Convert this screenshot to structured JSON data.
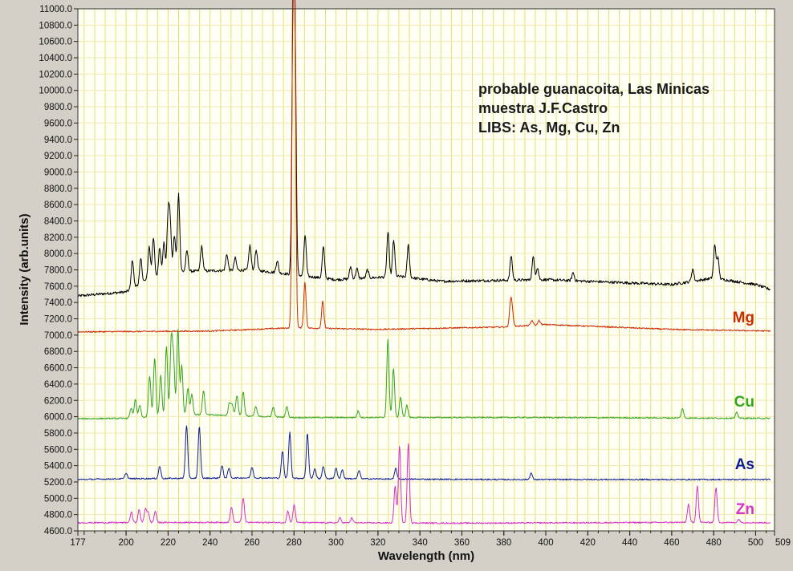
{
  "chart_data": {
    "type": "line",
    "title_lines": [
      "probable guanacoita, Las Minicas",
      "muestra J.F.Castro",
      "LIBS: As, Mg, Cu, Zn"
    ],
    "xlabel": "Wavelength (nm)",
    "ylabel": "Intensity (arb.units)",
    "xlim": [
      177,
      509
    ],
    "ylim": [
      4600,
      11000
    ],
    "x_ticks": [
      177,
      200,
      220,
      240,
      260,
      280,
      300,
      320,
      340,
      360,
      380,
      400,
      420,
      440,
      460,
      480,
      500,
      509
    ],
    "y_ticks": [
      4600.0,
      4800.0,
      5000.0,
      5200.0,
      5400.0,
      5600.0,
      5800.0,
      6000.0,
      6200.0,
      6400.0,
      6600.0,
      6800.0,
      7000.0,
      7200.0,
      7400.0,
      7600.0,
      7800.0,
      8000.0,
      8200.0,
      8400.0,
      8600.0,
      8800.0,
      9000.0,
      9200.0,
      9400.0,
      9600.0,
      9800.0,
      10000.0,
      10200.0,
      10400.0,
      10600.0,
      10800.0,
      11000.0
    ],
    "grid": true,
    "colors": {
      "plot_bg": "#fffff4",
      "frame_bg": "#d4d0c8",
      "grid": "#e6e07a"
    },
    "series": [
      {
        "color": "#000000",
        "baseline": [
          [
            177,
            7480
          ],
          [
            200,
            7530
          ],
          [
            210,
            7680
          ],
          [
            225,
            7780
          ],
          [
            260,
            7800
          ],
          [
            300,
            7680
          ],
          [
            330,
            7720
          ],
          [
            350,
            7660
          ],
          [
            400,
            7680
          ],
          [
            460,
            7620
          ],
          [
            480,
            7700
          ],
          [
            500,
            7620
          ],
          [
            507,
            7560
          ]
        ],
        "peaks": [
          [
            203,
            350
          ],
          [
            207,
            300
          ],
          [
            211,
            400
          ],
          [
            213,
            500
          ],
          [
            216,
            350
          ],
          [
            218,
            400
          ],
          [
            220,
            700
          ],
          [
            221,
            600
          ],
          [
            223,
            450
          ],
          [
            225,
            950
          ],
          [
            229,
            250
          ],
          [
            236,
            300
          ],
          [
            248,
            200
          ],
          [
            252,
            150
          ],
          [
            259,
            300
          ],
          [
            262,
            250
          ],
          [
            272,
            150
          ],
          [
            279.5,
            2850
          ],
          [
            280.5,
            2750
          ],
          [
            285.3,
            500
          ],
          [
            294,
            380
          ],
          [
            307,
            150
          ],
          [
            310,
            120
          ],
          [
            315,
            100
          ],
          [
            324.8,
            550
          ],
          [
            327.5,
            450
          ],
          [
            334.5,
            400
          ],
          [
            383.5,
            300
          ],
          [
            394,
            280
          ],
          [
            396,
            150
          ],
          [
            413,
            100
          ],
          [
            470,
            150
          ],
          [
            480.5,
            400
          ],
          [
            482,
            250
          ]
        ]
      },
      {
        "name": "Mg",
        "color": "#cc2a00",
        "baseline": [
          [
            177,
            7040
          ],
          [
            240,
            7050
          ],
          [
            280,
            7090
          ],
          [
            320,
            7070
          ],
          [
            380,
            7100
          ],
          [
            400,
            7130
          ],
          [
            420,
            7110
          ],
          [
            460,
            7070
          ],
          [
            507,
            7050
          ]
        ],
        "peaks": [
          [
            279.55,
            3700
          ],
          [
            280.3,
            3550
          ],
          [
            285.2,
            560
          ],
          [
            293.7,
            330
          ],
          [
            383.2,
            280
          ],
          [
            384,
            170
          ],
          [
            393.4,
            60
          ],
          [
            396.8,
            55
          ]
        ]
      },
      {
        "name": "Cu",
        "color": "#33a61e",
        "baseline": [
          [
            177,
            5975
          ],
          [
            200,
            5980
          ],
          [
            230,
            6030
          ],
          [
            280,
            5990
          ],
          [
            340,
            5990
          ],
          [
            400,
            5990
          ],
          [
            507,
            5980
          ]
        ],
        "peaks": [
          [
            202.4,
            120
          ],
          [
            204.4,
            220
          ],
          [
            206.5,
            150
          ],
          [
            211.2,
            500
          ],
          [
            213.6,
            720
          ],
          [
            216.5,
            500
          ],
          [
            219.2,
            850
          ],
          [
            221.5,
            900
          ],
          [
            222.6,
            650
          ],
          [
            224.7,
            1050
          ],
          [
            226.5,
            600
          ],
          [
            229.4,
            320
          ],
          [
            231.3,
            250
          ],
          [
            236.9,
            300
          ],
          [
            249.2,
            150
          ],
          [
            250.5,
            140
          ],
          [
            252.8,
            250
          ],
          [
            255.8,
            300
          ],
          [
            261.8,
            120
          ],
          [
            270.1,
            120
          ],
          [
            276.6,
            130
          ],
          [
            310.6,
            80
          ],
          [
            324.75,
            950
          ],
          [
            327.4,
            600
          ],
          [
            330.8,
            250
          ],
          [
            333.8,
            150
          ],
          [
            465.1,
            120
          ],
          [
            491,
            70
          ]
        ]
      },
      {
        "name": "As",
        "color": "#0e1f93",
        "baseline": [
          [
            177,
            5230
          ],
          [
            200,
            5240
          ],
          [
            260,
            5250
          ],
          [
            330,
            5235
          ],
          [
            380,
            5230
          ],
          [
            440,
            5230
          ],
          [
            507,
            5230
          ]
        ],
        "peaks": [
          [
            200,
            70
          ],
          [
            216,
            150
          ],
          [
            228.8,
            650
          ],
          [
            234.9,
            630
          ],
          [
            245.7,
            150
          ],
          [
            249,
            120
          ],
          [
            260,
            130
          ],
          [
            274.5,
            330
          ],
          [
            278,
            560
          ],
          [
            286.4,
            550
          ],
          [
            289.9,
            120
          ],
          [
            294,
            150
          ],
          [
            300,
            130
          ],
          [
            303,
            110
          ],
          [
            311,
            100
          ],
          [
            328.5,
            130
          ],
          [
            393,
            80
          ]
        ]
      },
      {
        "name": "Zn",
        "color": "#d632c6",
        "baseline": [
          [
            177,
            4700
          ],
          [
            250,
            4705
          ],
          [
            300,
            4700
          ],
          [
            360,
            4695
          ],
          [
            420,
            4700
          ],
          [
            470,
            4705
          ],
          [
            507,
            4700
          ]
        ],
        "peaks": [
          [
            202.5,
            130
          ],
          [
            206.2,
            160
          ],
          [
            209.2,
            170
          ],
          [
            210.5,
            120
          ],
          [
            213.9,
            140
          ],
          [
            250.2,
            190
          ],
          [
            255.8,
            300
          ],
          [
            277.1,
            140
          ],
          [
            280.1,
            220
          ],
          [
            301.9,
            60
          ],
          [
            307.6,
            60
          ],
          [
            328.2,
            450
          ],
          [
            330.3,
            950
          ],
          [
            334.5,
            980
          ],
          [
            468,
            220
          ],
          [
            472.2,
            450
          ],
          [
            481.1,
            430
          ],
          [
            492,
            40
          ]
        ]
      }
    ]
  }
}
